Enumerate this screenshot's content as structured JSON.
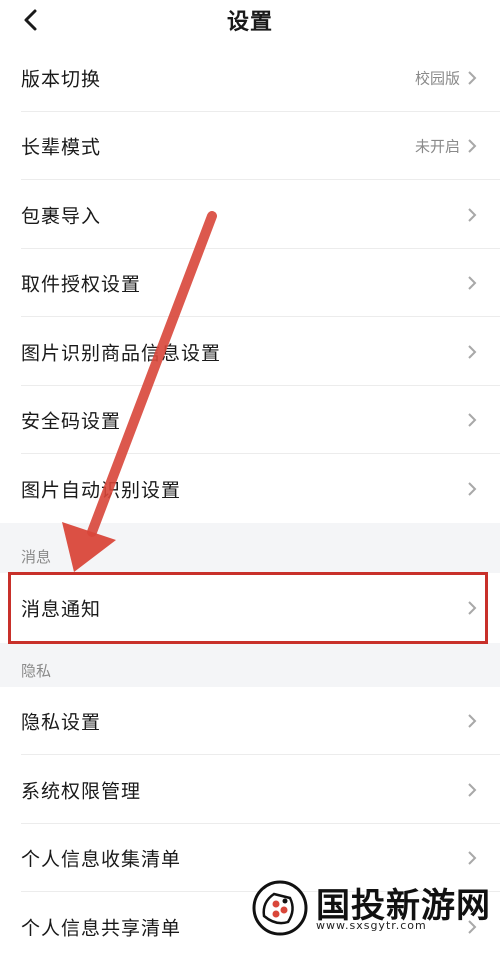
{
  "header": {
    "title": "设置",
    "back_icon": "chevron-left-icon"
  },
  "settings": {
    "items": [
      {
        "label": "版本切换",
        "value": "校园版"
      },
      {
        "label": "长辈模式",
        "value": "未开启"
      },
      {
        "label": "包裹导入",
        "value": ""
      },
      {
        "label": "取件授权设置",
        "value": ""
      },
      {
        "label": "图片识别商品信息设置",
        "value": ""
      },
      {
        "label": "安全码设置",
        "value": ""
      },
      {
        "label": "图片自动识别设置",
        "value": ""
      }
    ]
  },
  "messages_section": {
    "title": "消息",
    "items": [
      {
        "label": "消息通知",
        "value": ""
      }
    ]
  },
  "privacy_section": {
    "title": "隐私",
    "items": [
      {
        "label": "隐私设置",
        "value": ""
      },
      {
        "label": "系统权限管理",
        "value": ""
      },
      {
        "label": "个人信息收集清单",
        "value": ""
      },
      {
        "label": "个人信息共享清单",
        "value": ""
      }
    ]
  },
  "annotation": {
    "color": "#c8302a"
  },
  "watermark": {
    "text": "国投新游网",
    "url": "www.sxsgytr.com"
  }
}
